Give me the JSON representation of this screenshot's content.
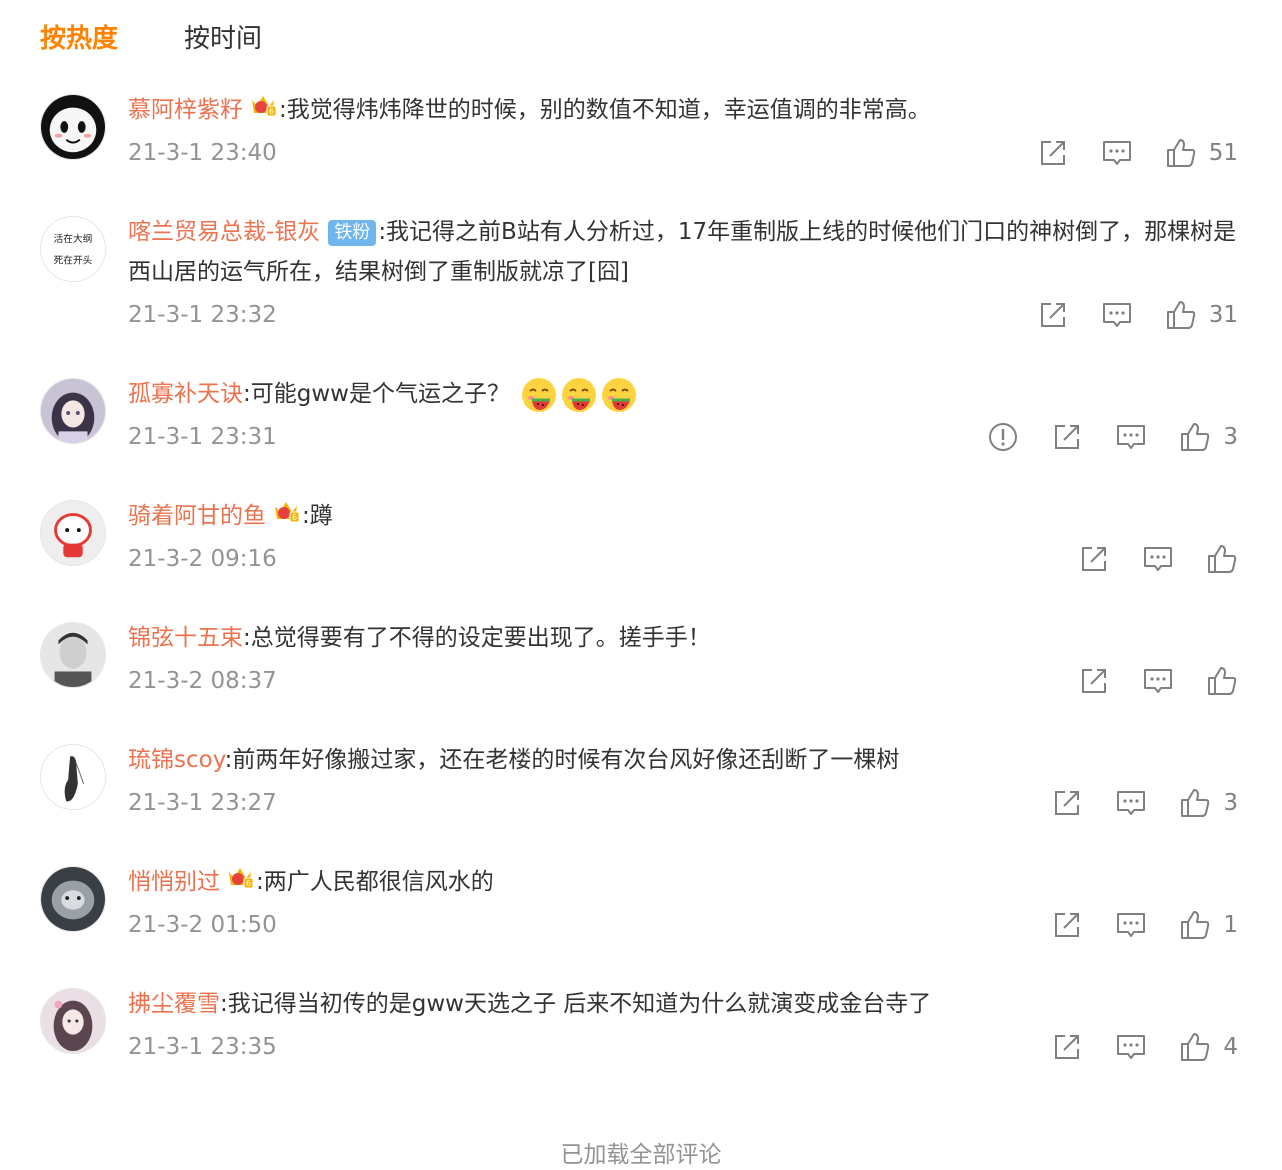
{
  "sort": {
    "hot_label": "按热度",
    "time_label": "按时间"
  },
  "comments": [
    {
      "user": "慕阿梓紫籽",
      "text": ":我觉得炜炜降世的时候，别的数值不知道，幸运值调的非常高。",
      "time": "21-3-1 23:40",
      "likes": "51"
    },
    {
      "user": "喀兰贸易总裁-银灰",
      "badge": "铁粉",
      "text": ":我记得之前B站有人分析过，17年重制版上线的时候他们门口的神树倒了，那棵树是西山居的运气所在，结果树倒了重制版就凉了[囧]",
      "time": "21-3-1 23:32",
      "likes": "31",
      "avatar_text": [
        "活在大纲",
        "死在开头"
      ]
    },
    {
      "user": "孤寡补天诀",
      "text": ":可能gww是个气运之子？",
      "time": "21-3-1 23:31",
      "likes": "3"
    },
    {
      "user": "骑着阿甘的鱼",
      "text": ":蹲",
      "time": "21-3-2 09:16",
      "likes": ""
    },
    {
      "user": "锦弦十五束",
      "text": ":总觉得要有了不得的设定要出现了。搓手手！",
      "time": "21-3-2 08:37",
      "likes": ""
    },
    {
      "user": "琉锦scoy",
      "text": ":前两年好像搬过家，还在老楼的时候有次台风好像还刮断了一棵树",
      "time": "21-3-1 23:27",
      "likes": "3"
    },
    {
      "user": "悄悄别过",
      "text": ":两广人民都很信风水的",
      "time": "21-3-2 01:50",
      "likes": "1"
    },
    {
      "user": "拂尘覆雪",
      "text": ":我记得当初传的是gww天选之子 后来不知道为什么就演变成金台寺了",
      "time": "21-3-1 23:35",
      "likes": "4"
    }
  ],
  "footer": {
    "load_more": "已加载全部评论"
  },
  "colors": {
    "accent": "#ff8200",
    "username": "#eb7350",
    "meta": "#939393",
    "fan_badge": "#6fb6ee"
  },
  "icons": [
    "report-icon",
    "share-icon",
    "comment-icon",
    "like-icon",
    "crown-badge-icon",
    "melon-emoji-icon"
  ]
}
